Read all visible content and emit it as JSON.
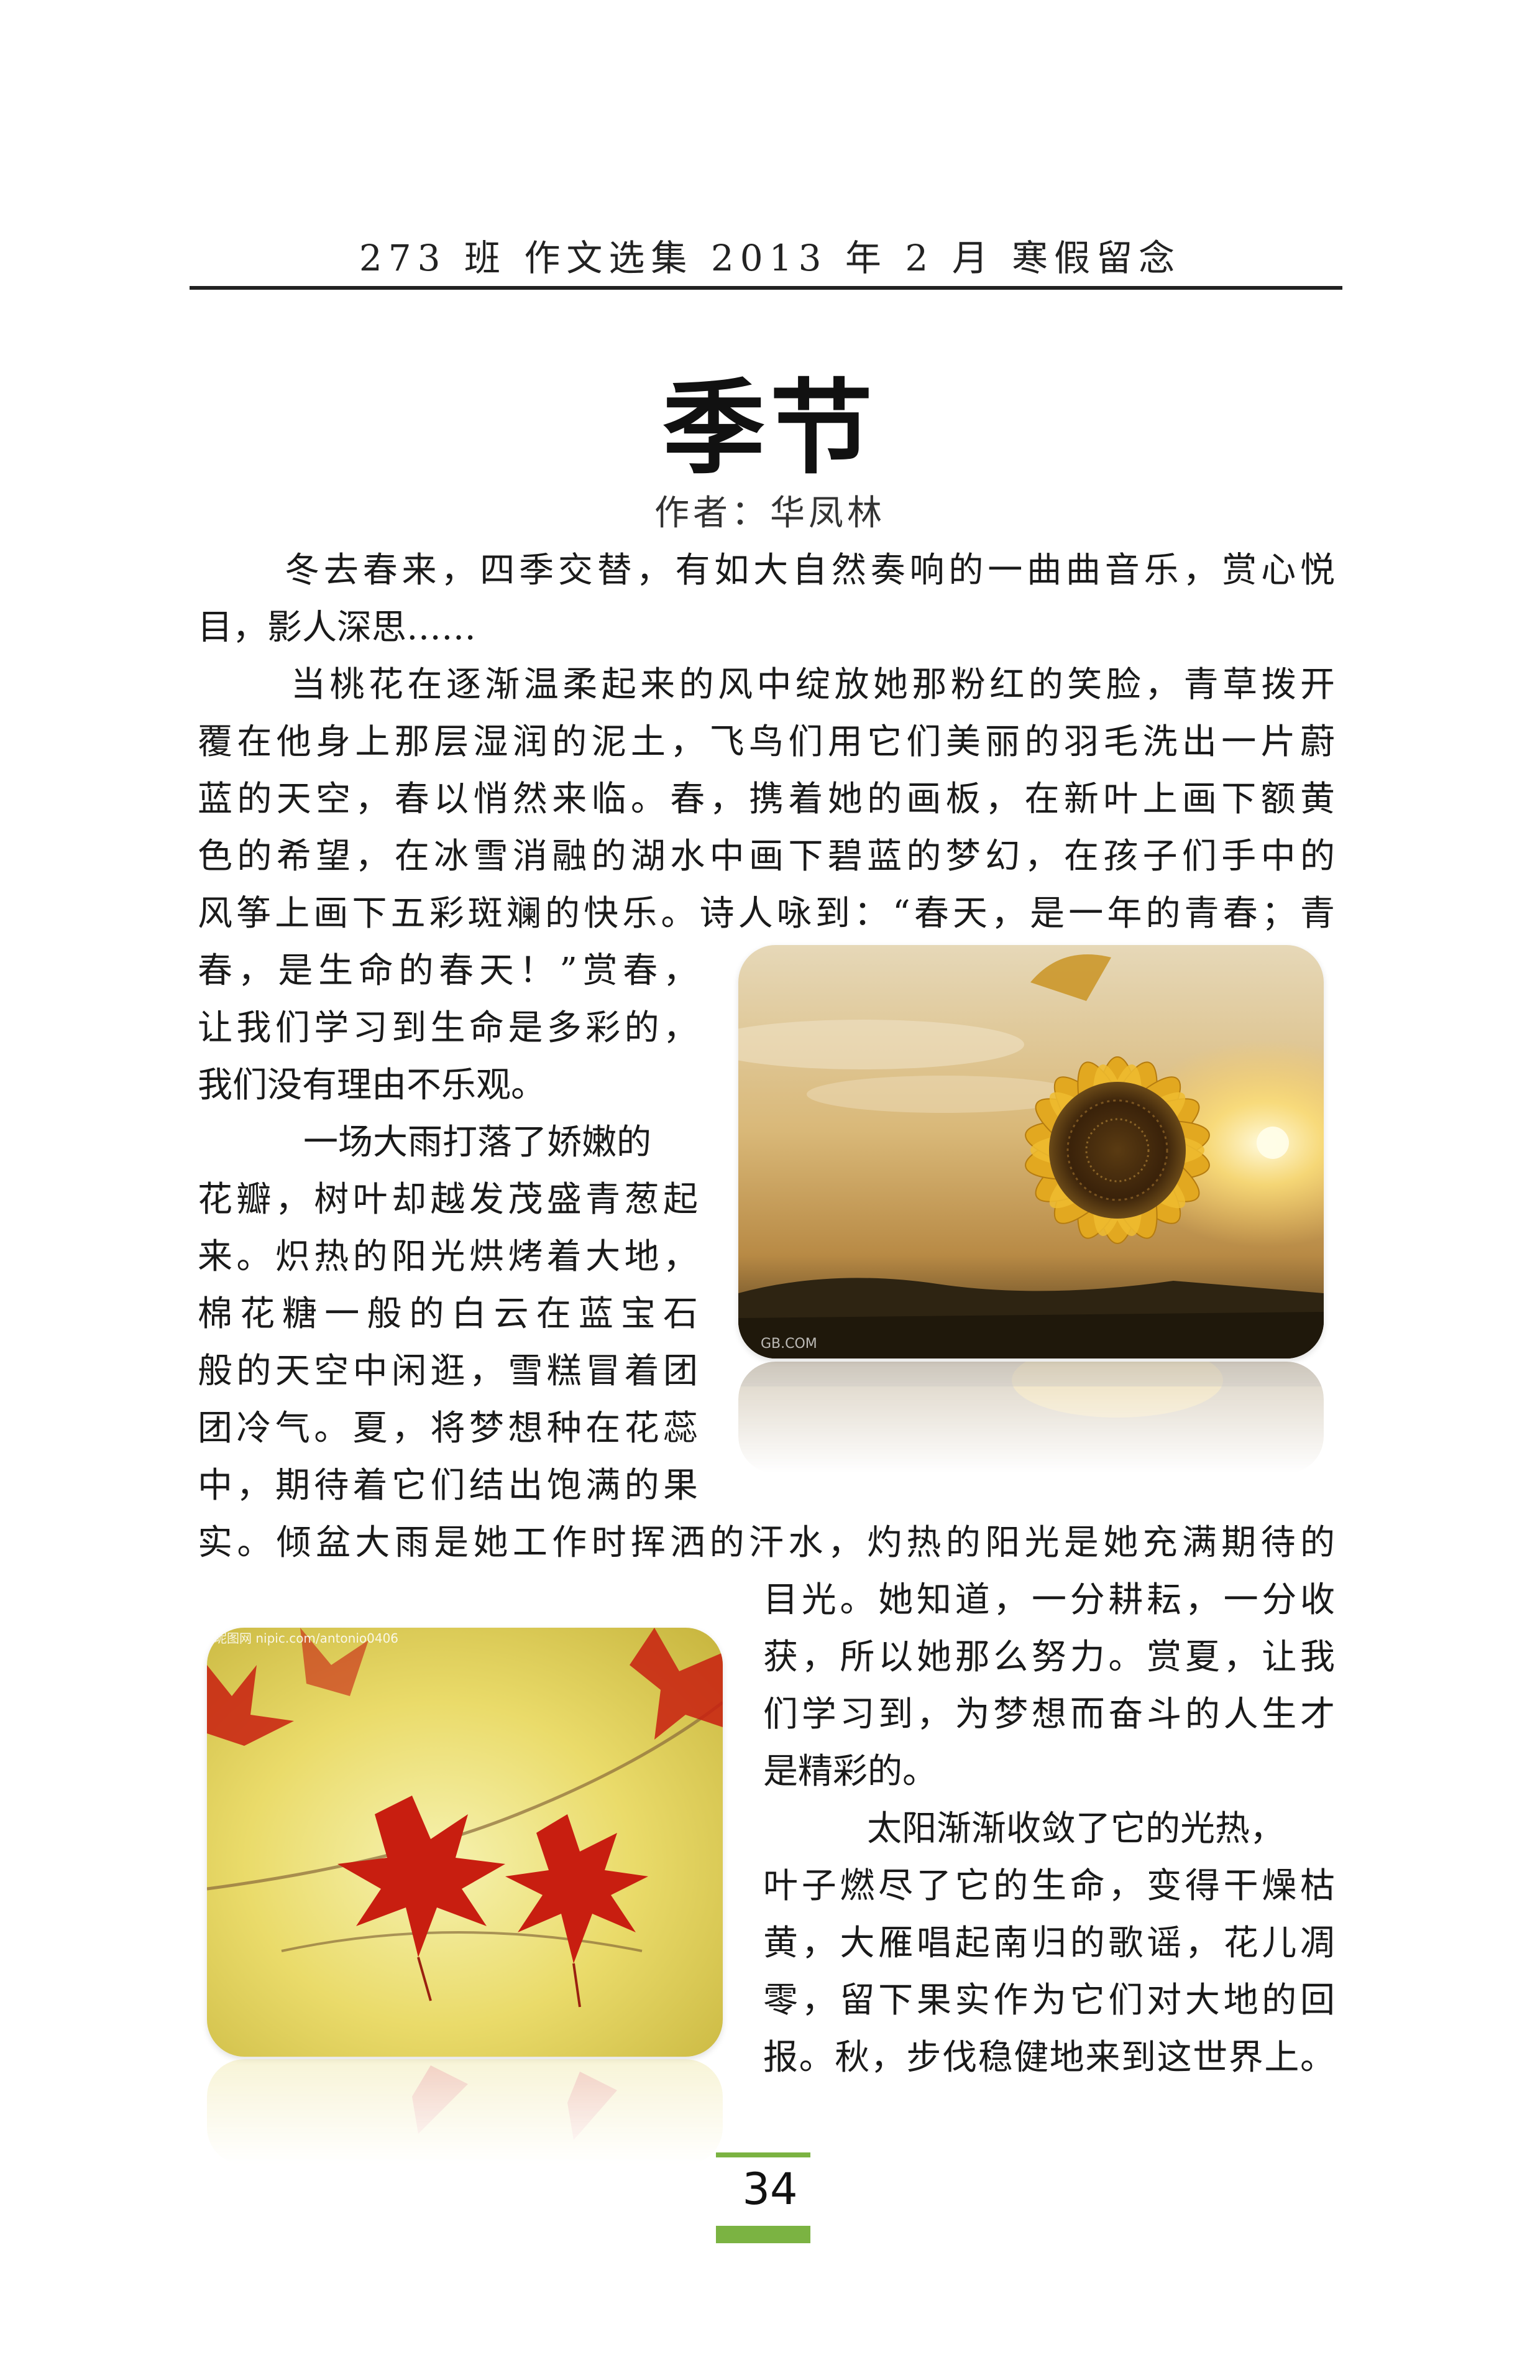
{
  "header": {
    "text": "273 班  作文选集  2013 年  2 月  寒假留念"
  },
  "article": {
    "title": "季节",
    "author": "作者：华凤林",
    "lines": {
      "p1_l1": "冬去春来，四季交替，有如大自然奏响的一曲曲音乐，赏心悦",
      "p1_l2": "目，影人深思……",
      "p2_l1": "当桃花在逐渐温柔起来的风中绽放她那粉红的笑脸，青草拨开",
      "p2_l2": "覆在他身上那层湿润的泥土，飞鸟们用它们美丽的羽毛洗出一片蔚",
      "p2_l3": "蓝的天空，春以悄然来临。春，携着她的画板，在新叶上画下额黄",
      "p2_l4": "色的希望，在冰雪消融的湖水中画下碧蓝的梦幻，在孩子们手中的",
      "p2_l5": "风筝上画下五彩斑斓的快乐。诗人咏到：“春天，是一年的青春；青",
      "p2_l6": "春，是生命的春天！”赏春，",
      "p2_l7": "让我们学习到生命是多彩的，",
      "p2_l8": "我们没有理由不乐观。",
      "p3_l1": "一场大雨打落了娇嫩的",
      "p3_l2": "花瓣，树叶却越发茂盛青葱起",
      "p3_l3": "来。炽热的阳光烘烤着大地，",
      "p3_l4": "棉花糖一般的白云在蓝宝石",
      "p3_l5": "般的天空中闲逛，雪糕冒着团",
      "p3_l6": "团冷气。夏，将梦想种在花蕊",
      "p3_l7": "中，期待着它们结出饱满的果",
      "p3_l8": "实。倾盆大雨是她工作时挥洒的汗水，灼热的阳光是她充满期待的",
      "p3_l9": "目光。她知道，一分耕耘，一分收",
      "p3_l10": "获，所以她那么努力。赏夏，让我",
      "p3_l11": "们学习到，为梦想而奋斗的人生才",
      "p3_l12": "是精彩的。",
      "p4_l1": "太阳渐渐收敛了它的光热，",
      "p4_l2": "叶子燃尽了它的生命，变得干燥枯",
      "p4_l3": "黄，大雁唱起南归的歌谣，花儿凋",
      "p4_l4": "零，留下果实作为它们对大地的回",
      "p4_l5": "报。秋，步伐稳健地来到这世界上。"
    }
  },
  "images": {
    "sunflower": {
      "icon": "sunflower-photo",
      "watermark": "GB.COM"
    },
    "maple": {
      "icon": "maple-leaves-photo",
      "watermark": "昵图网 nipic.com/antonio0406"
    }
  },
  "footer": {
    "page_number": "34",
    "accent_color": "#7bb342"
  }
}
